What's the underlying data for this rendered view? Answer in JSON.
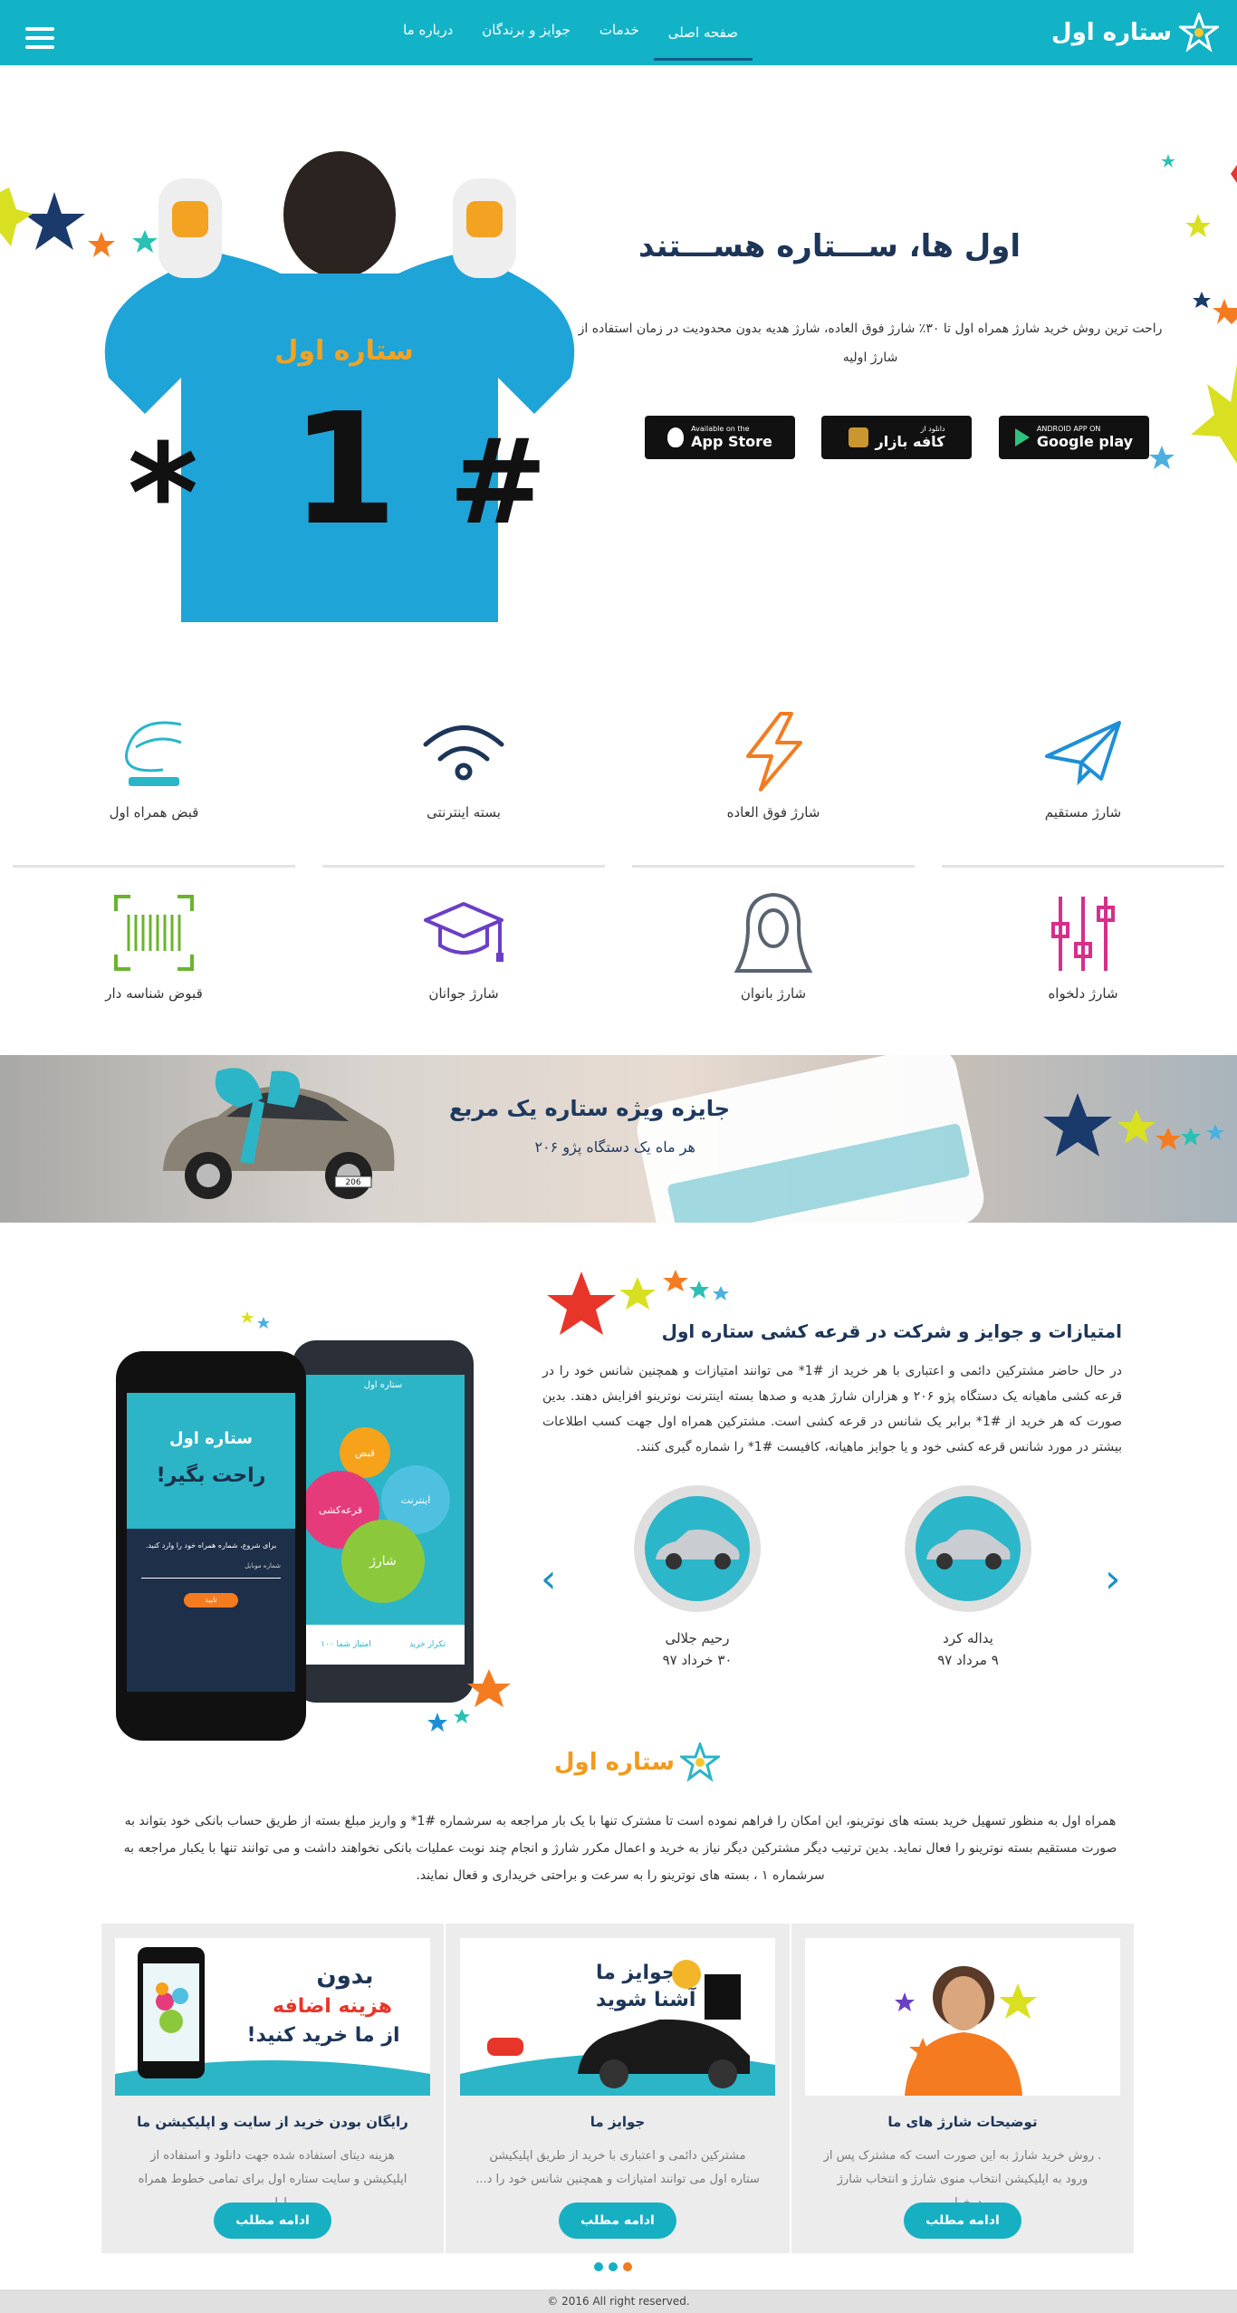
{
  "nav": {
    "logo_text": "ستاره اول",
    "items": [
      {
        "label": "صفحه اصلی",
        "active": true
      },
      {
        "label": "خدمات",
        "active": false
      },
      {
        "label": "جوایز و برندگان",
        "active": false
      },
      {
        "label": "درباره ما",
        "active": false
      }
    ]
  },
  "hero": {
    "title": "اول ها، ســـتاره هســـتند",
    "text": "راحت ترین روش خرید شارژ همراه اول تا ۳۰٪ شارژ فوق العاده، شارژ هدیه بدون محدودیت در زمان استفاده از شارژ اولیه",
    "player_number": "1",
    "player_left": "*",
    "player_right": "#",
    "jersey_text": "ستاره اول",
    "stores": [
      {
        "small": "ANDROID APP ON",
        "big": "Google play"
      },
      {
        "small": "دانلود از",
        "big": "کافه بازار"
      },
      {
        "small": "Available on the",
        "big": "App Store"
      }
    ]
  },
  "services": [
    {
      "label": "شارژ مستقیم",
      "icon": "paper-plane-icon"
    },
    {
      "label": "شارژ فوق العاده",
      "icon": "lightning-icon"
    },
    {
      "label": "بسته اینترنتی",
      "icon": "wifi-icon"
    },
    {
      "label": "قبض همراه اول",
      "icon": "mci-logo-icon"
    },
    {
      "label": "شارژ دلخواه",
      "icon": "sliders-icon"
    },
    {
      "label": "شارژ بانوان",
      "icon": "woman-icon"
    },
    {
      "label": "شارژ جوانان",
      "icon": "graduation-cap-icon"
    },
    {
      "label": "قبوض شناسه دار",
      "icon": "barcode-icon"
    }
  ],
  "banner": {
    "title": "جایزه ویژه ستاره یک مربع",
    "subtitle": "هر ماه یک دستگاه پژو ۲۰۶",
    "plate": "206"
  },
  "awards": {
    "title": "امتیازات و جوایز و شرکت در قرعه کشی ستاره اول",
    "text": "در حال حاضر مشترکین دائمی و اعتباری با هر خرید از #1* می توانند امتیازات و همچنین شانس خود را در قرعه کشی ماهیانه یک دستگاه پژو ۲۰۶ و هزاران شارژ هدیه و صدها بسته اینترنت نوترینو افزایش دهند. بدین صورت که هر خرید از #1* برابر یک شانس در قرعه کشی است. مشترکین همراه اول جهت کسب اطلاعات بیشتر در مورد شانس قرعه کشی خود و یا جوایز ماهیانه، کافیست #1* را شماره گیری کنند.",
    "winners": [
      {
        "name": "یداله کرد",
        "date": "۹ مرداد ۹۷"
      },
      {
        "name": "رحیم جلالی",
        "date": "۳۰ خرداد ۹۷"
      }
    ],
    "arrow_prev": "‹",
    "arrow_next": "›"
  },
  "phone": {
    "logo": "ستاره اول",
    "slogan": "راحت بگیر!",
    "hint": "برای شروع، شماره همراه خود را وارد کنید.",
    "field_label": "شماره موبایل",
    "submit": "تایید",
    "app_title": "ستاره اول",
    "bubbles": [
      "قبض",
      "اینترنت",
      "قرعه‌کشی",
      "شارژ"
    ],
    "bottom": [
      "تکرار خرید",
      "امتیاز شما ۱۰۰"
    ]
  },
  "intro": {
    "logo": "ستاره اول",
    "text": "همراه اول به منظور تسهیل خرید بسته های نوترینو، این امکان را فراهم نموده است تا مشترک تنها با یک بار مراجعه به سرشماره #1* و واریز مبلغ بسته از طریق حساب بانکی خود بتواند به صورت مستقیم بسته نوترینو را فعال نماید. بدین ترتیب دیگر مشترکین دیگر نیاز به خرید و اعمال مکرر شارژ و انجام چند نوبت عملیات بانکی نخواهند داشت و می توانند تنها با یکبار مراجعه به سرشماره ۱ ، بسته های نوترینو را به سرعت و براحتی خریداری و فعال نمایند."
  },
  "cards": [
    {
      "title": "توضیحات شارژ های ما",
      "text": ". روش خرید شارژ به این صورت است که مشترک پس از ورود به اپلیکیشن انتخاب منوی شارژ و انتخاب شارژ درخوا...",
      "more": "ادامه مطلب"
    },
    {
      "title": "جوایز ما",
      "text": "مشترکین دائمی و اعتباری با خرید از طریق اپلیکیشن ستاره اول می توانند امتیازات و همچنین شانس خود را د...",
      "more": "ادامه مطلب",
      "img_text": [
        "با جوایز ما",
        "آشنا شوید"
      ]
    },
    {
      "title": "رایگان بودن خرید از سایت و اپلیکیشن ما",
      "text": "هزینه دیتای استفاده شده جهت دانلود و استفاده از اپلیکیشن و سایت ستاره اول برای تمامی خطوط همراه اول...",
      "more": "ادامه مطلب",
      "img_text": [
        "بدون",
        "هزینه اضافه",
        "از ما خرید کنید!"
      ]
    }
  ],
  "dots": [
    "#17b0c3",
    "#17b0c3",
    "#f07c1c"
  ],
  "footer": "© 2016 All right reserved.",
  "colors": {
    "brand": "#12b3c7",
    "navy": "#1d3557",
    "orange": "#f29a1d"
  }
}
